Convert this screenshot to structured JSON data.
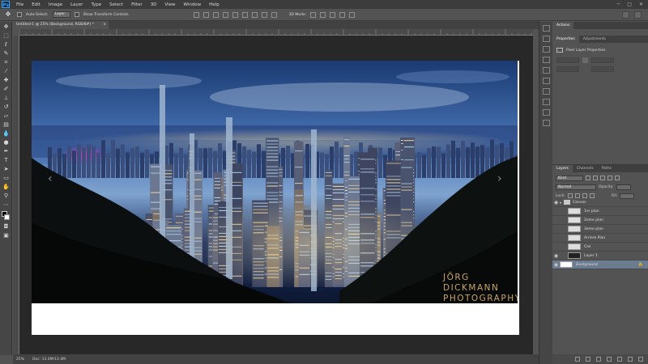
{
  "app": {
    "logo": "Ps"
  },
  "menu": [
    "File",
    "Edit",
    "Image",
    "Layer",
    "Type",
    "Select",
    "Filter",
    "3D",
    "View",
    "Window",
    "Help"
  ],
  "options": {
    "auto_select_label": "Auto-Select:",
    "auto_select_target": "Layer",
    "transform_label": "Show Transform Controls",
    "mode_label": "3D Mode:"
  },
  "document": {
    "tab_title": "Untitled-1 @ 25% (Background, RGB/8#) *",
    "close": "×"
  },
  "watermark": {
    "line1": "JÖRG DICKMANN",
    "line2": "PHOTOGRAPHY"
  },
  "status": {
    "zoom": "25%",
    "doc_info": "Doc: 13.4M/13.4M"
  },
  "panels": {
    "actions_tab": "Actions",
    "properties_tabs": [
      "Properties",
      "Adjustments"
    ],
    "properties_title": "Pixel Layer Properties",
    "layers_tabs": [
      "Layers",
      "Channels",
      "Paths"
    ],
    "kind_label": "Kind",
    "blend_mode": "Normal",
    "opacity_label": "Opacity:",
    "lock_label": "Lock:",
    "fill_label": "Fill:"
  },
  "layers": [
    {
      "name": "Canvas",
      "type": "group",
      "visible": true
    },
    {
      "name": "1er plan",
      "type": "pixel",
      "visible": false
    },
    {
      "name": "2eme plan",
      "type": "pixel",
      "visible": false
    },
    {
      "name": "3eme plan",
      "type": "pixel",
      "visible": false
    },
    {
      "name": "Arriere Plan",
      "type": "pixel",
      "visible": false
    },
    {
      "name": "Ciel",
      "type": "pixel",
      "visible": false
    },
    {
      "name": "Layer 1",
      "type": "pixel",
      "visible": true
    },
    {
      "name": "Background",
      "type": "background",
      "visible": true,
      "locked": true,
      "selected": true
    }
  ],
  "colors": {
    "accent": "#31a8ff",
    "selected_row": "#6b7c91",
    "watermark": "#c9a562"
  }
}
